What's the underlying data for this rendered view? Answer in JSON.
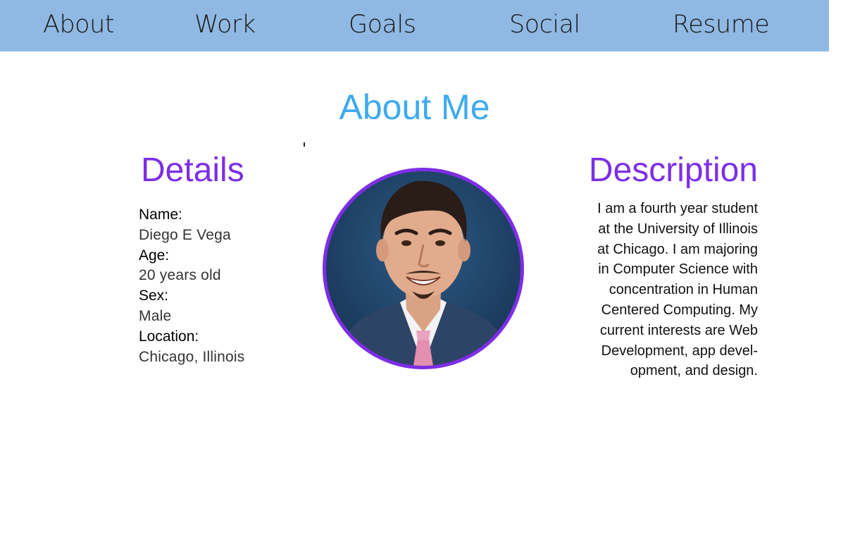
{
  "nav": {
    "items": [
      "About",
      "Work",
      "Goals",
      "Social",
      "Resume"
    ]
  },
  "colors": {
    "nav_background": "#8fb9e3",
    "title": "#3eaaf0",
    "heading_accent": "#7d2ee6"
  },
  "main": {
    "title": "About Me",
    "details": {
      "heading": "Details",
      "fields": [
        {
          "label": "Name:",
          "value": "Diego E Vega"
        },
        {
          "label": "Age:",
          "value": "20 years old"
        },
        {
          "label": "Sex:",
          "value": "Male"
        },
        {
          "label": "Location:",
          "value": "Chicago, Illinois"
        }
      ]
    },
    "description": {
      "heading": "Description",
      "lines": [
        "I am a fourth year student",
        "at the University of Illinois",
        "at Chicago. I am majoring",
        "in Computer Science with",
        "concentration in Human",
        "Centered Computing. My",
        "current interests are Web",
        "Development, app devel-",
        "opment, and design."
      ]
    }
  }
}
